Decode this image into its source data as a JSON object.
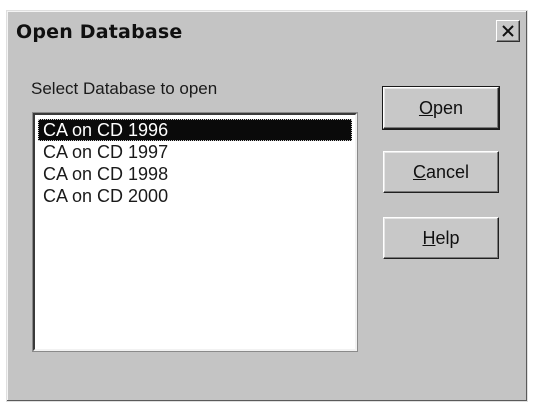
{
  "dialog": {
    "title": "Open Database",
    "close_glyph": "✕"
  },
  "prompt": "Select Database to open",
  "databases": [
    {
      "label": "CA on CD 1996",
      "selected": true
    },
    {
      "label": "CA on CD 1997",
      "selected": false
    },
    {
      "label": "CA on CD 1998",
      "selected": false
    },
    {
      "label": "CA on CD 2000",
      "selected": false
    }
  ],
  "buttons": {
    "open": {
      "mnemonic": "O",
      "rest": "pen"
    },
    "cancel": {
      "mnemonic": "C",
      "rest": "ancel"
    },
    "help": {
      "mnemonic": "H",
      "rest": "elp"
    }
  }
}
